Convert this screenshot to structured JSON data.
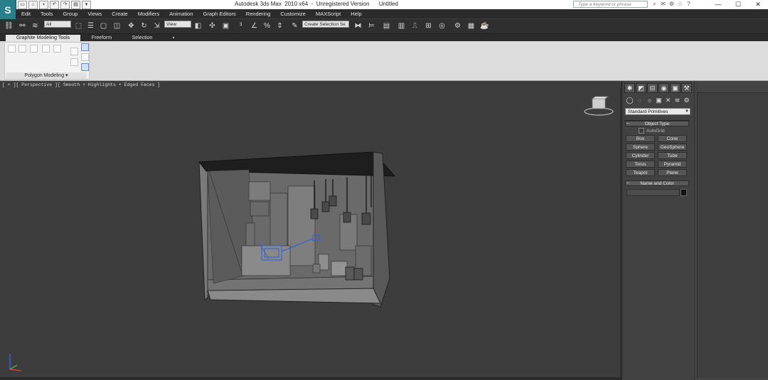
{
  "window": {
    "title": "Autodesk 3ds Max  2010 x64  -  Unregistered Version      Untitled",
    "app_logo": "S",
    "search_placeholder": "Type a keyword or phrase",
    "controls": {
      "minimize": "—",
      "maximize": "☐",
      "close": "✕"
    }
  },
  "menu": {
    "items": [
      "Edit",
      "Tools",
      "Group",
      "Views",
      "Create",
      "Modifiers",
      "Animation",
      "Graph Editors",
      "Rendering",
      "Customize",
      "MAXScript",
      "Help"
    ]
  },
  "toolbar": {
    "selection_filter": "All",
    "reference_coord": "View",
    "named_selection": "Create Selection Se"
  },
  "ribbon": {
    "tabs": [
      "Graphite Modeling Tools",
      "Freeform",
      "Selection"
    ],
    "panel_label": "Polygon Modeling"
  },
  "viewport": {
    "label": "[ + ][ Perspective ][ Smooth + Highlights + Edged Faces ]"
  },
  "command_panel": {
    "tab_icons": [
      "create-icon",
      "modify-icon",
      "hierarchy-icon",
      "motion-icon",
      "display-icon",
      "utilities-icon"
    ],
    "category_dropdown": "Standard Primitives",
    "object_type": {
      "header": "Object Type",
      "autogrid": "AutoGrid",
      "buttons": [
        "Box",
        "Cone",
        "Sphere",
        "GeoSphere",
        "Cylinder",
        "Tube",
        "Torus",
        "Pyramid",
        "Teapot",
        "Plane"
      ]
    },
    "name_and_color": {
      "header": "Name and Color",
      "name_value": ""
    }
  },
  "colors": {
    "viewport_bg": "#3d3d3d",
    "selection_highlight": "#2f5fd6",
    "title_bar": "#ffffff"
  }
}
